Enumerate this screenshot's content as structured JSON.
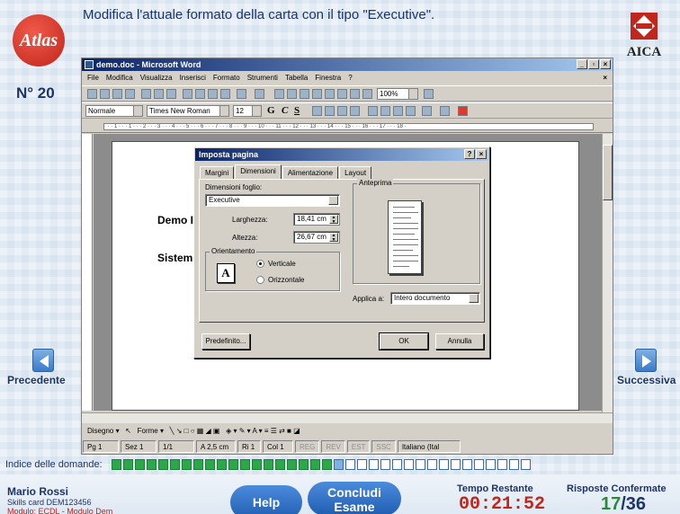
{
  "question": {
    "text": "Modifica l'attuale formato della carta con il tipo \"Executive\".",
    "number": "N° 20"
  },
  "logos": {
    "left": "Atlas",
    "right": "AICA"
  },
  "nav": {
    "prev": "Precedente",
    "next": "Successiva"
  },
  "word": {
    "title": "demo.doc - Microsoft Word",
    "menu": [
      "File",
      "Modifica",
      "Visualizza",
      "Inserisci",
      "Formato",
      "Strumenti",
      "Tabella",
      "Finestra",
      "?"
    ],
    "style": "Normale",
    "font": "Times New Roman",
    "size": "12",
    "zoom": "100%",
    "bold": "G",
    "italic": "C",
    "underline": "S",
    "ruler": "· · · 1 · · · 1 · · · 2 · · · 3 · · · 4 · · · 5 · · · 6 · · · 7 · · · 8 · · · 9 · · · 10 · · · 11 · · · 12 · · · 13 · · · 14 · · · 15 · · · 16 · · · 17 · · · 18 ·",
    "doc_line1": "Demo I",
    "doc_line2": "Sistem",
    "draw_label": "Disegno",
    "shapes_label": "Forme",
    "status": {
      "page": "Pg 1",
      "section": "Sez 1",
      "pages": "1/1",
      "at": "A 2,5 cm",
      "line": "Ri 1",
      "col": "Col 1",
      "rec": "REG",
      "rev": "REV",
      "ext": "EST",
      "ovr": "SSC",
      "lang": "Italiano (Ital"
    }
  },
  "dialog": {
    "title": "Imposta pagina",
    "tabs": [
      "Margini",
      "Dimensioni",
      "Alimentazione",
      "Layout"
    ],
    "paper_size_label": "Dimensioni foglio:",
    "paper_size": "Executive",
    "width_label": "Larghezza:",
    "width_value": "18,41 cm",
    "height_label": "Altezza:",
    "height_value": "26,67 cm",
    "orientation_label": "Orientamento",
    "portrait": "Verticale",
    "landscape": "Orizzontale",
    "preview_label": "Anteprima",
    "apply_label": "Applica a:",
    "apply_value": "Intero documento",
    "default_btn": "Predefinito...",
    "ok": "OK",
    "cancel": "Annulla",
    "help": "?"
  },
  "bottom": {
    "index_label": "Indice delle domande:",
    "index": {
      "done": 19,
      "current": 20,
      "total": 36
    },
    "user_name": "Mario Rossi",
    "skills": "Skills card DEM123456",
    "module": "Modulo: ECDL - Modulo Dem",
    "help": "Help",
    "end": "Concludi Esame",
    "time_label": "Tempo Restante",
    "time": "00:21:52",
    "conf_label": "Risposte Confermate",
    "conf_current": "17",
    "conf_total": "/36"
  },
  "colors": {
    "accent": "#1d3466",
    "brand_red": "#c0261b",
    "done_green": "#2aa84a"
  }
}
